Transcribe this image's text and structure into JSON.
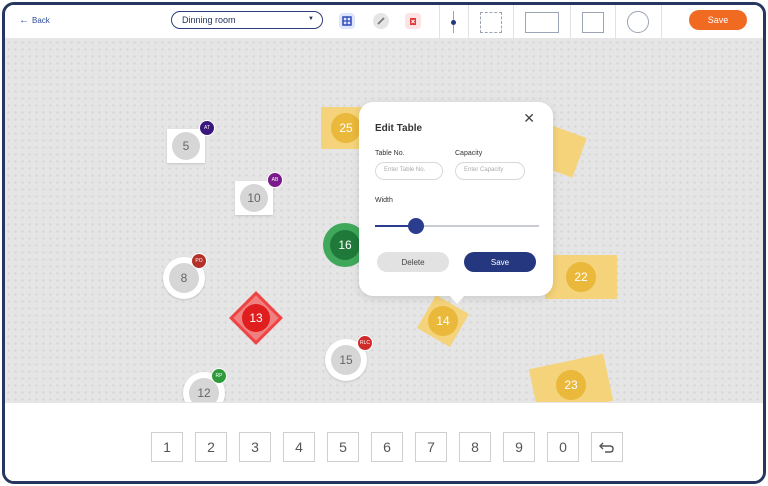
{
  "toolbar": {
    "back_label": "Back",
    "room_selected": "Dinning room",
    "save_label": "Save"
  },
  "tables": [
    {
      "number": "5",
      "badge": "AT",
      "badge_color": "#3a177d"
    },
    {
      "number": "10",
      "badge": "AB",
      "badge_color": "#7a1a8c"
    },
    {
      "number": "8",
      "badge": "PO",
      "badge_color": "#b2322a"
    },
    {
      "number": "13",
      "badge": "",
      "badge_color": ""
    },
    {
      "number": "12",
      "badge": "RP",
      "badge_color": "#2e9b3a"
    },
    {
      "number": "15",
      "badge": "RLC",
      "badge_color": "#d02a2a"
    },
    {
      "number": "16",
      "badge": "",
      "badge_color": ""
    },
    {
      "number": "25",
      "badge": "",
      "badge_color": ""
    },
    {
      "number": "14",
      "badge": "",
      "badge_color": ""
    },
    {
      "number": "22",
      "badge": "",
      "badge_color": ""
    },
    {
      "number": "23",
      "badge": "",
      "badge_color": ""
    }
  ],
  "popup": {
    "title": "Edit Table",
    "table_no_label": "Table No.",
    "table_no_placeholder": "Enter Table No.",
    "capacity_label": "Capacity",
    "capacity_placeholder": "Enter Capacity",
    "width_label": "Width",
    "width_fraction": 0.25,
    "delete_label": "Delete",
    "save_label": "Save"
  },
  "keypad": [
    "1",
    "2",
    "3",
    "4",
    "5",
    "6",
    "7",
    "8",
    "9",
    "0"
  ],
  "colors": {
    "accent": "#f16a22",
    "primary": "#24377f",
    "frame": "#25375f"
  }
}
